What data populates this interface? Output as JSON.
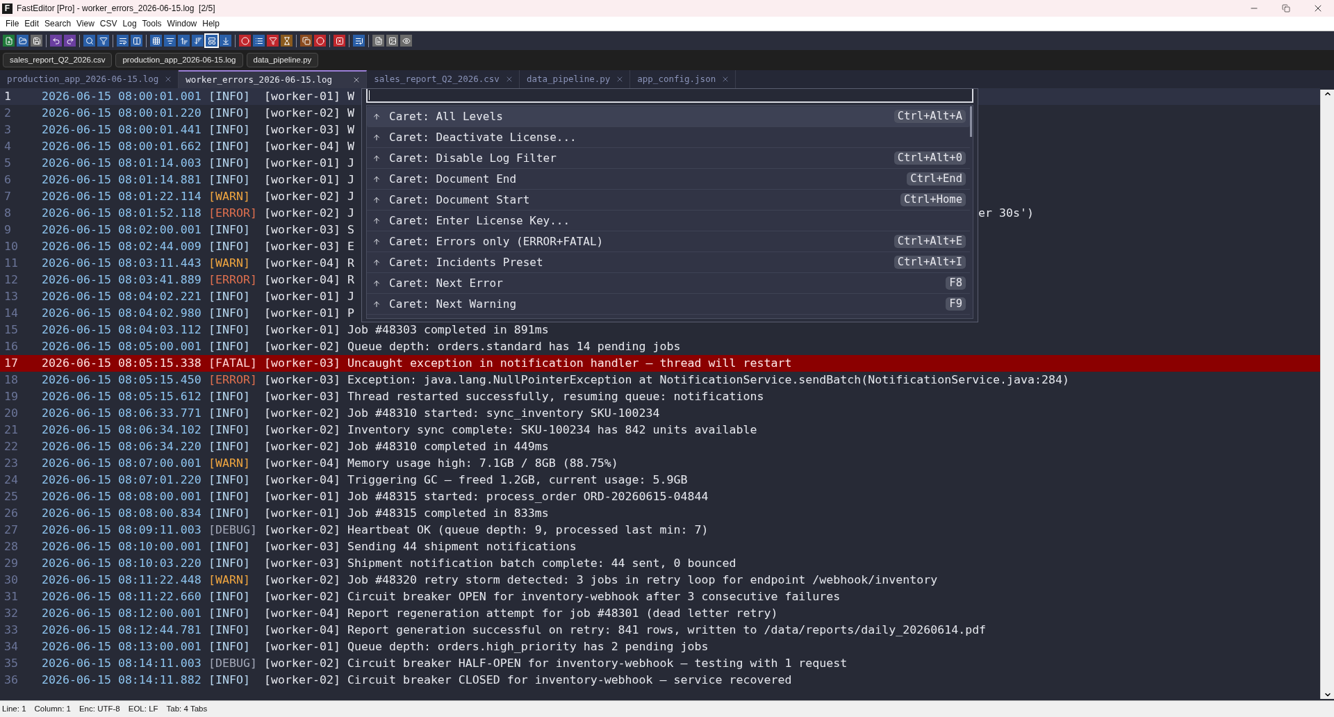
{
  "window": {
    "icon_letter": "F",
    "title": "FastEditor [Pro] - worker_errors_2026-06-15.log  [2/5]"
  },
  "menu": [
    "File",
    "Edit",
    "Search",
    "View",
    "CSV",
    "Log",
    "Tools",
    "Window",
    "Help"
  ],
  "open_files": [
    "sales_report_Q2_2026.csv",
    "production_app_2026-06-15.log",
    "data_pipeline.py"
  ],
  "tabs": [
    {
      "label": "production_app_2026-06-15.log",
      "selected": false
    },
    {
      "label": "worker_errors_2026-06-15.log",
      "selected": true
    },
    {
      "label": "sales_report_Q2_2026.csv",
      "selected": false
    },
    {
      "label": "data_pipeline.py",
      "selected": false
    },
    {
      "label": "app_config.json",
      "selected": false
    }
  ],
  "lines": [
    {
      "no": "1",
      "time": "2026-06-15 08:00:01.001",
      "tag": "[INFO]",
      "kind": "info",
      "worker": "[worker-01]",
      "msg": "W",
      "current": true,
      "highlighted": false
    },
    {
      "no": "2",
      "time": "2026-06-15 08:00:01.220",
      "tag": "[INFO]",
      "kind": "info",
      "worker": "[worker-02]",
      "msg": "W",
      "current": false,
      "highlighted": false
    },
    {
      "no": "3",
      "time": "2026-06-15 08:00:01.441",
      "tag": "[INFO]",
      "kind": "info",
      "worker": "[worker-03]",
      "msg": "W",
      "current": false,
      "highlighted": false
    },
    {
      "no": "4",
      "time": "2026-06-15 08:00:01.662",
      "tag": "[INFO]",
      "kind": "info",
      "worker": "[worker-04]",
      "msg": "W",
      "current": false,
      "highlighted": false
    },
    {
      "no": "5",
      "time": "2026-06-15 08:01:14.003",
      "tag": "[INFO]",
      "kind": "info",
      "worker": "[worker-01]",
      "msg": "J",
      "current": false,
      "highlighted": false
    },
    {
      "no": "6",
      "time": "2026-06-15 08:01:14.881",
      "tag": "[INFO]",
      "kind": "info",
      "worker": "[worker-01]",
      "msg": "J",
      "current": false,
      "highlighted": false
    },
    {
      "no": "7",
      "time": "2026-06-15 08:01:22.114",
      "tag": "[WARN]",
      "kind": "warn",
      "worker": "[worker-02]",
      "msg": "J",
      "current": false,
      "highlighted": false
    },
    {
      "no": "8",
      "time": "2026-06-15 08:01:52.118",
      "tag": "[ERROR]",
      "kind": "error",
      "worker": "[worker-02]",
      "msg": "J",
      "tail": "er 30s')",
      "current": false,
      "highlighted": false
    },
    {
      "no": "9",
      "time": "2026-06-15 08:02:00.001",
      "tag": "[INFO]",
      "kind": "info",
      "worker": "[worker-03]",
      "msg": "S",
      "current": false,
      "highlighted": false
    },
    {
      "no": "10",
      "time": "2026-06-15 08:02:44.009",
      "tag": "[INFO]",
      "kind": "info",
      "worker": "[worker-03]",
      "msg": "E",
      "current": false,
      "highlighted": false
    },
    {
      "no": "11",
      "time": "2026-06-15 08:03:11.443",
      "tag": "[WARN]",
      "kind": "warn",
      "worker": "[worker-04]",
      "msg": "R",
      "current": false,
      "highlighted": false
    },
    {
      "no": "12",
      "time": "2026-06-15 08:03:41.889",
      "tag": "[ERROR]",
      "kind": "error",
      "worker": "[worker-04]",
      "msg": "R",
      "current": false,
      "highlighted": false
    },
    {
      "no": "13",
      "time": "2026-06-15 08:04:02.221",
      "tag": "[INFO]",
      "kind": "info",
      "worker": "[worker-01]",
      "msg": "J",
      "current": false,
      "highlighted": false
    },
    {
      "no": "14",
      "time": "2026-06-15 08:04:02.980",
      "tag": "[INFO]",
      "kind": "info",
      "worker": "[worker-01]",
      "msg": "P",
      "current": false,
      "highlighted": false
    },
    {
      "no": "15",
      "time": "2026-06-15 08:04:03.112",
      "tag": "[INFO]",
      "kind": "info",
      "worker": "[worker-01]",
      "msg": "Job #48303 completed in 891ms",
      "current": false,
      "highlighted": false
    },
    {
      "no": "16",
      "time": "2026-06-15 08:05:00.001",
      "tag": "[INFO]",
      "kind": "info",
      "worker": "[worker-02]",
      "msg": "Queue depth: orders.standard has 14 pending jobs",
      "current": false,
      "highlighted": false
    },
    {
      "no": "17",
      "time": "2026-06-15 08:05:15.338",
      "tag": "[FATAL]",
      "kind": "fatal",
      "worker": "[worker-03]",
      "msg": "Uncaught exception in notification handler — thread will restart",
      "current": false,
      "highlighted": true
    },
    {
      "no": "18",
      "time": "2026-06-15 08:05:15.450",
      "tag": "[ERROR]",
      "kind": "error",
      "worker": "[worker-03]",
      "msg": "Exception: java.lang.NullPointerException at NotificationService.sendBatch(NotificationService.java:284)",
      "current": false,
      "highlighted": false
    },
    {
      "no": "19",
      "time": "2026-06-15 08:05:15.612",
      "tag": "[INFO]",
      "kind": "info",
      "worker": "[worker-03]",
      "msg": "Thread restarted successfully, resuming queue: notifications",
      "current": false,
      "highlighted": false
    },
    {
      "no": "20",
      "time": "2026-06-15 08:06:33.771",
      "tag": "[INFO]",
      "kind": "info",
      "worker": "[worker-02]",
      "msg": "Job #48310 started: sync_inventory SKU-100234",
      "current": false,
      "highlighted": false
    },
    {
      "no": "21",
      "time": "2026-06-15 08:06:34.102",
      "tag": "[INFO]",
      "kind": "info",
      "worker": "[worker-02]",
      "msg": "Inventory sync complete: SKU-100234 has 842 units available",
      "current": false,
      "highlighted": false
    },
    {
      "no": "22",
      "time": "2026-06-15 08:06:34.220",
      "tag": "[INFO]",
      "kind": "info",
      "worker": "[worker-02]",
      "msg": "Job #48310 completed in 449ms",
      "current": false,
      "highlighted": false
    },
    {
      "no": "23",
      "time": "2026-06-15 08:07:00.001",
      "tag": "[WARN]",
      "kind": "warn",
      "worker": "[worker-04]",
      "msg": "Memory usage high: 7.1GB / 8GB (88.75%)",
      "current": false,
      "highlighted": false
    },
    {
      "no": "24",
      "time": "2026-06-15 08:07:01.220",
      "tag": "[INFO]",
      "kind": "info",
      "worker": "[worker-04]",
      "msg": "Triggering GC — freed 1.2GB, current usage: 5.9GB",
      "current": false,
      "highlighted": false
    },
    {
      "no": "25",
      "time": "2026-06-15 08:08:00.001",
      "tag": "[INFO]",
      "kind": "info",
      "worker": "[worker-01]",
      "msg": "Job #48315 started: process_order ORD-20260615-04844",
      "current": false,
      "highlighted": false
    },
    {
      "no": "26",
      "time": "2026-06-15 08:08:00.834",
      "tag": "[INFO]",
      "kind": "info",
      "worker": "[worker-01]",
      "msg": "Job #48315 completed in 833ms",
      "current": false,
      "highlighted": false
    },
    {
      "no": "27",
      "time": "2026-06-15 08:09:11.003",
      "tag": "[DEBUG]",
      "kind": "debug",
      "worker": "[worker-02]",
      "msg": "Heartbeat OK (queue depth: 9, processed last min: 7)",
      "current": false,
      "highlighted": false
    },
    {
      "no": "28",
      "time": "2026-06-15 08:10:00.001",
      "tag": "[INFO]",
      "kind": "info",
      "worker": "[worker-03]",
      "msg": "Sending 44 shipment notifications",
      "current": false,
      "highlighted": false
    },
    {
      "no": "29",
      "time": "2026-06-15 08:10:03.220",
      "tag": "[INFO]",
      "kind": "info",
      "worker": "[worker-03]",
      "msg": "Shipment notification batch complete: 44 sent, 0 bounced",
      "current": false,
      "highlighted": false
    },
    {
      "no": "30",
      "time": "2026-06-15 08:11:22.448",
      "tag": "[WARN]",
      "kind": "warn",
      "worker": "[worker-02]",
      "msg": "Job #48320 retry storm detected: 3 jobs in retry loop for endpoint /webhook/inventory",
      "current": false,
      "highlighted": false
    },
    {
      "no": "31",
      "time": "2026-06-15 08:11:22.660",
      "tag": "[INFO]",
      "kind": "info",
      "worker": "[worker-02]",
      "msg": "Circuit breaker OPEN for inventory-webhook after 3 consecutive failures",
      "current": false,
      "highlighted": false
    },
    {
      "no": "32",
      "time": "2026-06-15 08:12:00.001",
      "tag": "[INFO]",
      "kind": "info",
      "worker": "[worker-04]",
      "msg": "Report regeneration attempt for job #48301 (dead letter retry)",
      "current": false,
      "highlighted": false
    },
    {
      "no": "33",
      "time": "2026-06-15 08:12:44.781",
      "tag": "[INFO]",
      "kind": "info",
      "worker": "[worker-04]",
      "msg": "Report generation successful on retry: 841 rows, written to /data/reports/daily_20260614.pdf",
      "current": false,
      "highlighted": false
    },
    {
      "no": "34",
      "time": "2026-06-15 08:13:00.001",
      "tag": "[INFO]",
      "kind": "info",
      "worker": "[worker-01]",
      "msg": "Queue depth: orders.high_priority has 2 pending jobs",
      "current": false,
      "highlighted": false
    },
    {
      "no": "35",
      "time": "2026-06-15 08:14:11.003",
      "tag": "[DEBUG]",
      "kind": "debug",
      "worker": "[worker-02]",
      "msg": "Circuit breaker HALF-OPEN for inventory-webhook — testing with 1 request",
      "current": false,
      "highlighted": false
    },
    {
      "no": "36",
      "time": "2026-06-15 08:14:11.882",
      "tag": "[INFO]",
      "kind": "info",
      "worker": "[worker-02]",
      "msg": "Circuit breaker CLOSED for inventory-webhook — service recovered",
      "current": false,
      "highlighted": false
    }
  ],
  "palette": {
    "items": [
      {
        "label": "Caret: All Levels",
        "shortcut": "Ctrl+Alt+A",
        "selected": true
      },
      {
        "label": "Caret: Deactivate License...",
        "selected": false
      },
      {
        "label": "Caret: Disable Log Filter",
        "shortcut": "Ctrl+Alt+0",
        "selected": false
      },
      {
        "label": "Caret: Document End",
        "shortcut": "Ctrl+End",
        "selected": false
      },
      {
        "label": "Caret: Document Start",
        "shortcut": "Ctrl+Home",
        "selected": false
      },
      {
        "label": "Caret: Enter License Key...",
        "selected": false
      },
      {
        "label": "Caret: Errors only (ERROR+FATAL)",
        "shortcut": "Ctrl+Alt+E",
        "selected": false
      },
      {
        "label": "Caret: Incidents Preset",
        "shortcut": "Ctrl+Alt+I",
        "selected": false
      },
      {
        "label": "Caret: Next Error",
        "shortcut": "F8",
        "selected": false
      },
      {
        "label": "Caret: Next Warning",
        "shortcut": "F9",
        "selected": false
      }
    ]
  },
  "status_bar": [
    "Line: 1",
    "Column: 1",
    "Enc: UTF-8",
    "EOL: LF",
    "Tab: 4 Tabs"
  ]
}
